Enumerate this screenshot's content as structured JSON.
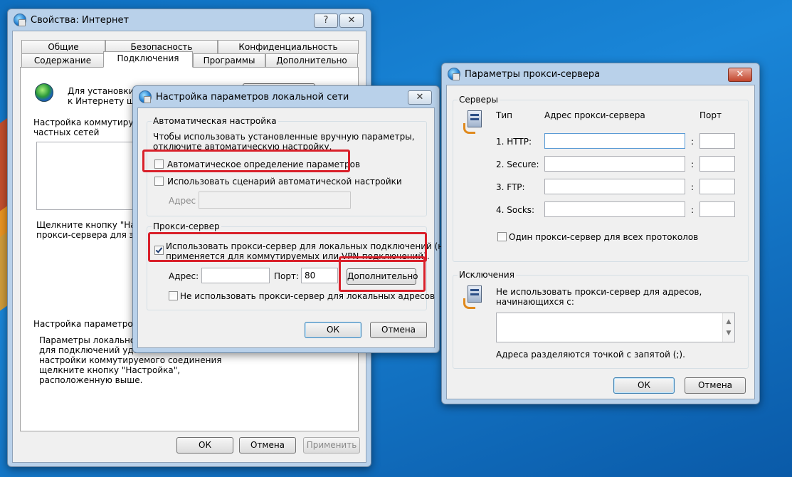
{
  "colors": {
    "highlight": "#d9202a",
    "desktop": "#1a86d8",
    "titlebar": "#b9d1ea"
  },
  "inet": {
    "title": "Свойства: Интернет",
    "tabs_row1": [
      "Общие",
      "Безопасность",
      "Конфиденциальность"
    ],
    "tabs_row2": [
      "Содержание",
      "Подключения",
      "Программы",
      "Дополнительно"
    ],
    "setup_text_1": "Для установки п",
    "setup_text_2": "к Интернету щ",
    "dialup_label_1": "Настройка коммутируемо",
    "dialup_label_2": "частных сетей",
    "proxy_hint_1": "Щелкните кнопку \"Наст",
    "proxy_hint_2": "прокси-сервера для это",
    "lan_label": "Настройка параметров л",
    "lan_desc": [
      "Параметры локальной с",
      "для подключений удал",
      "настройки коммутируемого соединения",
      "щелкните кнопку \"Настройка\",",
      "расположенную выше."
    ],
    "ok": "ОК",
    "cancel": "Отмена",
    "apply": "Применить"
  },
  "lan": {
    "title": "Настройка параметров локальной сети",
    "auto_group": "Автоматическая настройка",
    "auto_desc_1": "Чтобы использовать установленные вручную параметры,",
    "auto_desc_2": "отключите автоматическую настройку.",
    "auto_detect": "Автоматическое определение параметров",
    "auto_script": "Использовать сценарий автоматической настройки",
    "address_label": "Адрес",
    "proxy_group": "Прокси-сервер",
    "use_proxy_1": "Использовать прокси-сервер для локальных подключений (не",
    "use_proxy_2": "применяется для коммутируемых или VPN-подключений).",
    "addr_label": "Адрес:",
    "port_label": "Порт:",
    "port_value": "80",
    "advanced": "Дополнительно",
    "bypass_local": "Не использовать прокси-сервер для локальных адресов",
    "ok": "ОК",
    "cancel": "Отмена"
  },
  "proxy": {
    "title": "Параметры прокси-сервера",
    "servers_group": "Серверы",
    "col_type": "Тип",
    "col_address": "Адрес прокси-сервера",
    "col_port": "Порт",
    "rows": [
      {
        "label": "1. HTTP:",
        "colon": ":"
      },
      {
        "label": "2. Secure:",
        "colon": ":"
      },
      {
        "label": "3. FTP:",
        "colon": ":"
      },
      {
        "label": "4. Socks:",
        "colon": ":"
      }
    ],
    "same_proxy": "Один прокси-сервер для всех протоколов",
    "exceptions_group": "Исключения",
    "exc_desc_1": "Не использовать прокси-сервер для адресов,",
    "exc_desc_2": "начинающихся с:",
    "exc_hint": "Адреса разделяются точкой с запятой (;).",
    "ok": "ОК",
    "cancel": "Отмена"
  }
}
